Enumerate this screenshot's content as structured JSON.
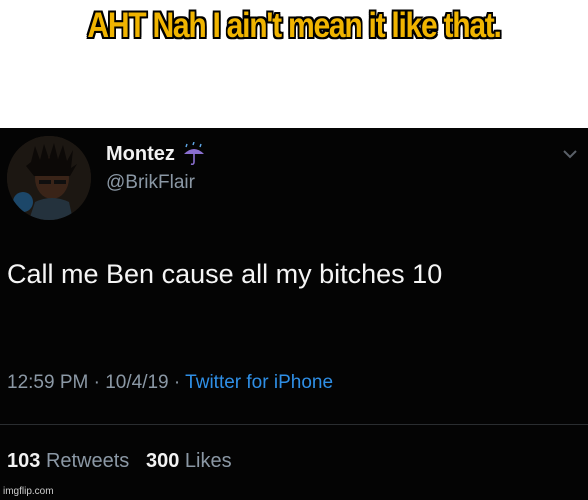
{
  "caption": {
    "text": "AHT Nah I ain't mean it like that.",
    "color": "#f0b400"
  },
  "tweet": {
    "display_name": "Montez",
    "name_icon": "umbrella-rain-icon",
    "handle": "@BrikFlair",
    "text": "Call me Ben cause all my bitches 10",
    "time": "12:59 PM",
    "date": "10/4/19",
    "source": "Twitter for iPhone",
    "separator": " · ",
    "retweets_count": "103",
    "retweets_label": "Retweets",
    "likes_count": "300",
    "likes_label": "Likes",
    "background": "#040404",
    "link_color": "#2f8fe6"
  },
  "watermark": "imgflip.com"
}
